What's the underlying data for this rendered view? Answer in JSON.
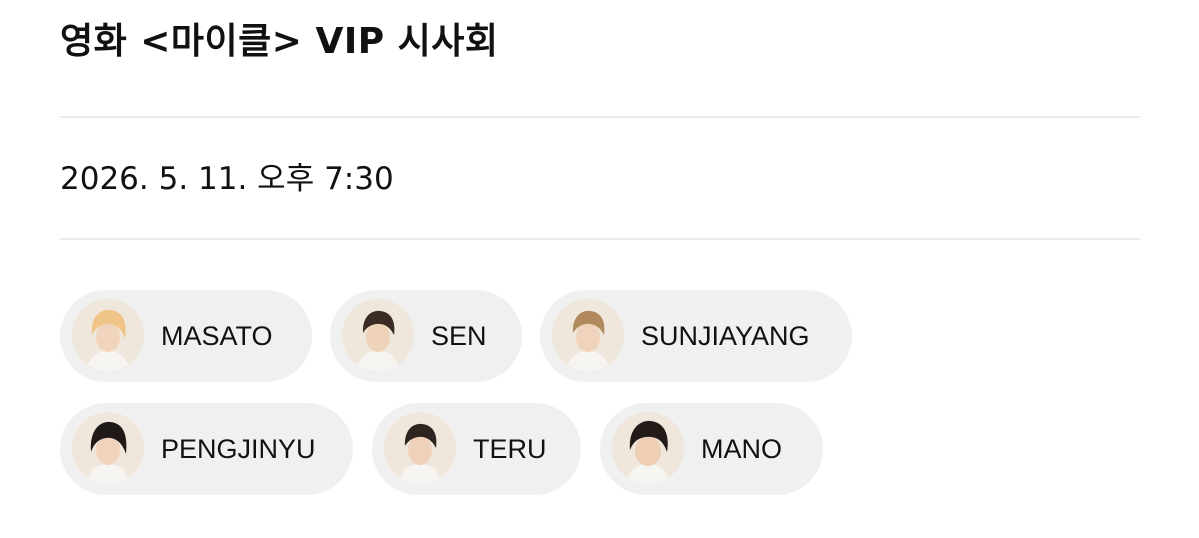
{
  "event": {
    "title": "영화 <마이클> VIP 시사회",
    "datetime": "2026. 5. 11. 오후 7:30"
  },
  "colors": {
    "background": "#ffffff",
    "divider": "#ececec",
    "chip_background": "#f0f0f0",
    "text": "#111111"
  },
  "attendees": [
    {
      "name": "MASATO",
      "avatar_icon": "person-photo-icon"
    },
    {
      "name": "SEN",
      "avatar_icon": "person-photo-icon"
    },
    {
      "name": "SUNJIAYANG",
      "avatar_icon": "person-photo-icon"
    },
    {
      "name": "PENGJINYU",
      "avatar_icon": "person-photo-icon"
    },
    {
      "name": "TERU",
      "avatar_icon": "person-photo-icon"
    },
    {
      "name": "MANO",
      "avatar_icon": "person-photo-icon"
    }
  ]
}
